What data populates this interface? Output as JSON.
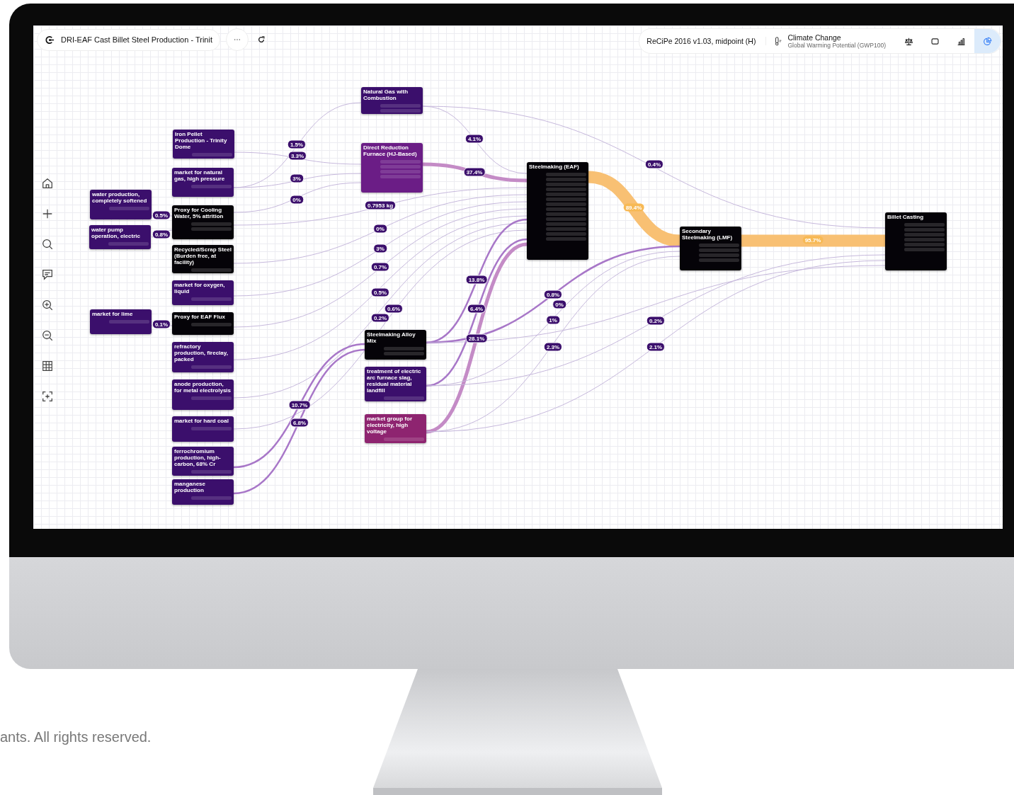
{
  "toolbar": {
    "title": "DRI-EAF Cast Billet Steel Production - Trinit"
  },
  "impact": {
    "method": "ReCiPe 2016 v1.03, midpoint (H)",
    "category": "Climate Change",
    "indicator": "Global Warming Potential (GWP100)"
  },
  "view_buttons": [
    {
      "kind": "scale",
      "selected": false
    },
    {
      "kind": "square",
      "selected": false
    },
    {
      "kind": "bars",
      "selected": false
    },
    {
      "kind": "pie",
      "selected": true
    }
  ],
  "side_tools": [
    {
      "kind": "home"
    },
    {
      "kind": "plus"
    },
    {
      "kind": "search"
    },
    {
      "kind": "comment"
    },
    {
      "kind": "zoomin"
    },
    {
      "kind": "zoomout"
    },
    {
      "kind": "grid"
    },
    {
      "kind": "focus"
    }
  ],
  "nodes": [
    {
      "title": "Natural Gas with Combustion",
      "kind": "database"
    },
    {
      "title": "Iron Pellet Production - Trinity Dome",
      "kind": "database"
    },
    {
      "title": "market for natural gas, high pressure",
      "kind": "database"
    },
    {
      "title": "Direct Reduction Furnace (HJ-Based)",
      "kind": "focus"
    },
    {
      "title": "water production, completely softened",
      "kind": "database"
    },
    {
      "title": "water pump operation, electric",
      "kind": "database"
    },
    {
      "title": "Proxy for Cooling Water, 5% attrition",
      "kind": "proxy"
    },
    {
      "title": "Recycled/Scrap Steel (Burden free, at facility)",
      "kind": "proxy"
    },
    {
      "title": "market for oxygen, liquid",
      "kind": "database"
    },
    {
      "title": "market for lime",
      "kind": "database"
    },
    {
      "title": "Proxy for EAF Flux",
      "kind": "proxy"
    },
    {
      "title": "refractory production, fireclay, packed",
      "kind": "database"
    },
    {
      "title": "anode production, for metal electrolysis",
      "kind": "database"
    },
    {
      "title": "market for hard coal",
      "kind": "database"
    },
    {
      "title": "ferrochromium production, high-carbon, 68% Cr",
      "kind": "database"
    },
    {
      "title": "manganese production",
      "kind": "database"
    },
    {
      "title": "Steelmaking Alloy Mix",
      "kind": "proxy"
    },
    {
      "title": "treatment of electric arc furnace slag, residual material landfill",
      "kind": "database"
    },
    {
      "title": "market group for electricity, high voltage",
      "kind": "electricity"
    },
    {
      "title": "Steelmaking (EAF)",
      "kind": "proxy"
    },
    {
      "title": "Secondary Steelmaking (LMF)",
      "kind": "proxy"
    },
    {
      "title": "Billet Casting",
      "kind": "proxy"
    }
  ],
  "flows": [
    {
      "label": "37.4%",
      "kind": "thick"
    },
    {
      "label": "89.4%",
      "kind": "main"
    },
    {
      "label": "95.7%",
      "kind": "main"
    },
    {
      "label": "4.1%",
      "kind": "thin"
    },
    {
      "label": "0.4%",
      "kind": "thin"
    },
    {
      "label": "1.5%",
      "kind": "thin"
    },
    {
      "label": "3.3%",
      "kind": "thin"
    },
    {
      "label": "3%",
      "kind": "thin"
    },
    {
      "label": "0%",
      "kind": "thin"
    },
    {
      "label": "0.5%",
      "kind": "thin"
    },
    {
      "label": "0.8%",
      "kind": "thin"
    },
    {
      "label": "0.1%",
      "kind": "thin"
    },
    {
      "label": "0.7953 kg",
      "kind": "thin"
    },
    {
      "label": "0%",
      "kind": "thin"
    },
    {
      "label": "3%",
      "kind": "thin"
    },
    {
      "label": "0.7%",
      "kind": "thin"
    },
    {
      "label": "0.5%",
      "kind": "thin"
    },
    {
      "label": "0.6%",
      "kind": "thin"
    },
    {
      "label": "0.2%",
      "kind": "thin"
    },
    {
      "label": "10.7%",
      "kind": "medium"
    },
    {
      "label": "6.8%",
      "kind": "medium"
    },
    {
      "label": "13.8%",
      "kind": "medium"
    },
    {
      "label": "6.4%",
      "kind": "medium"
    },
    {
      "label": "28.1%",
      "kind": "thick"
    },
    {
      "label": "0.8%",
      "kind": "medium"
    },
    {
      "label": "0%",
      "kind": "thin"
    },
    {
      "label": "1%",
      "kind": "thin"
    },
    {
      "label": "2.3%",
      "kind": "thin"
    },
    {
      "label": "0.2%",
      "kind": "thin"
    },
    {
      "label": "2.1%",
      "kind": "thin"
    }
  ],
  "footer": {
    "text": "ants. All rights reserved."
  }
}
